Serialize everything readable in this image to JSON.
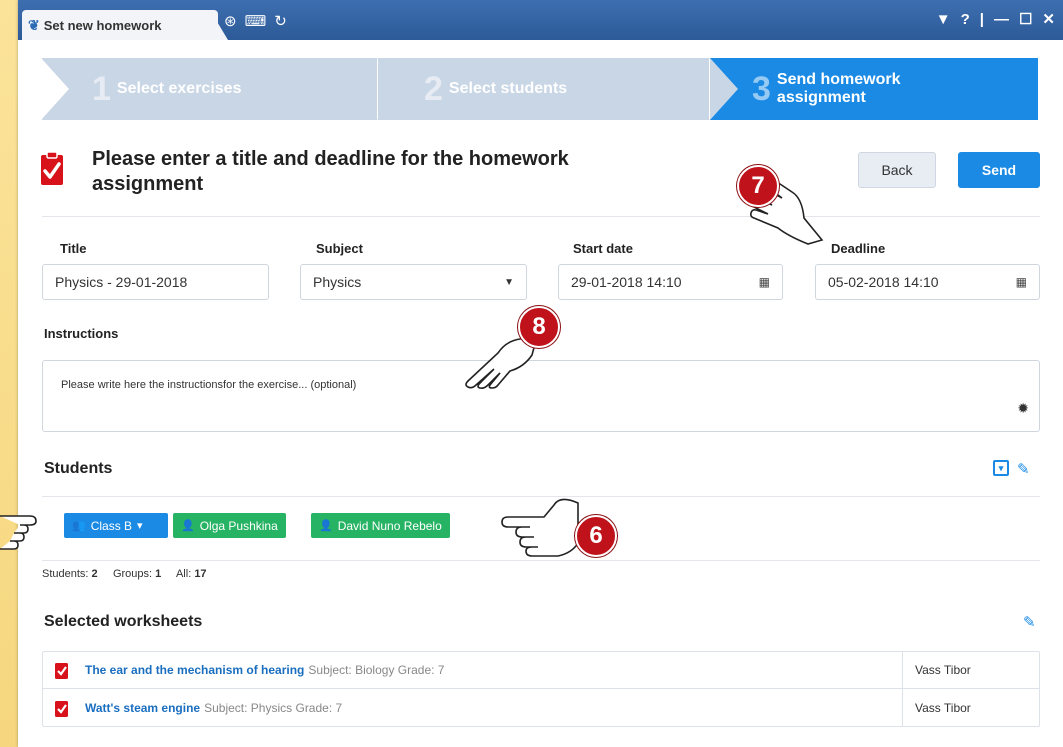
{
  "window": {
    "tab_title": "Set new homework",
    "controls": [
      "▼",
      "?",
      "|",
      "—",
      "☐",
      "✕"
    ]
  },
  "wizard": {
    "steps": [
      {
        "num": "1",
        "label": "Select exercises"
      },
      {
        "num": "2",
        "label": "Select students"
      },
      {
        "num": "3",
        "label": "Send homework assignment"
      }
    ],
    "active_step": 3
  },
  "header": {
    "title": "Please enter a title and deadline for the homework assignment",
    "back_label": "Back",
    "send_label": "Send"
  },
  "form": {
    "title_label": "Title",
    "title_value": "Physics - 29-01-2018",
    "subject_label": "Subject",
    "subject_value": "Physics",
    "start_label": "Start date",
    "start_value": "29-01-2018 14:10",
    "deadline_label": "Deadline",
    "deadline_value": "05-02-2018 14:10",
    "instructions_label": "Instructions",
    "instructions_placeholder": "Please write here the instructionsfor the exercise... (optional)"
  },
  "students": {
    "title": "Students",
    "chips": [
      {
        "label": "Class B",
        "type": "group"
      },
      {
        "label": "Olga Pushkina",
        "type": "student"
      },
      {
        "label": "David Nuno Rebelo",
        "type": "student"
      }
    ],
    "counts": {
      "students_label": "Students:",
      "students": "2",
      "groups_label": "Groups:",
      "groups": "1",
      "all_label": "All:",
      "all": "17"
    }
  },
  "worksheets": {
    "title": "Selected worksheets",
    "rows": [
      {
        "name": "The ear and the mechanism of hearing",
        "meta": "Subject: Biology Grade: 7",
        "author": "Vass Tibor"
      },
      {
        "name": "Watt's steam engine",
        "meta": "Subject: Physics Grade: 7",
        "author": "Vass Tibor"
      }
    ]
  },
  "annotations": {
    "m6": "6",
    "m7": "7",
    "m8": "8"
  },
  "colors": {
    "accent": "#1a8ae5",
    "green": "#26b363",
    "marker": "#c0121a",
    "titlebar": "#2d5a98"
  }
}
